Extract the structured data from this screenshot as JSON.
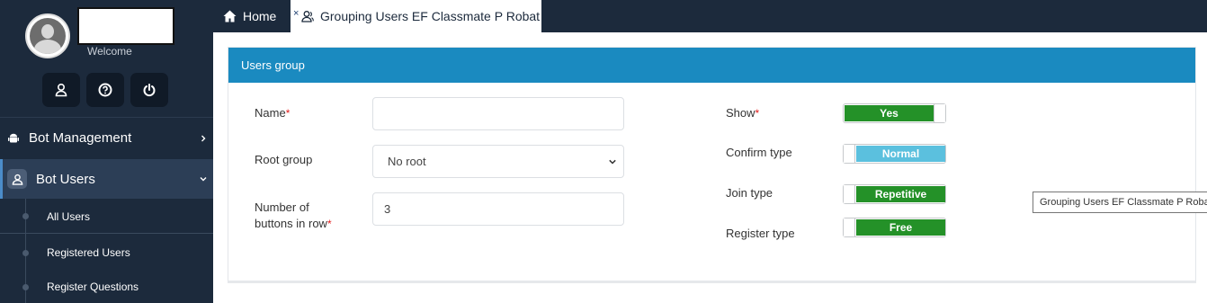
{
  "sidebar": {
    "welcome": "Welcome",
    "icons": [
      "user-profile-icon",
      "help-icon",
      "power-icon"
    ],
    "menu": [
      {
        "label": "Bot Management",
        "icon": "android-icon"
      },
      {
        "label": "Bot Users",
        "icon": "users-icon",
        "expanded": true
      }
    ],
    "submenu": [
      {
        "label": "All Users",
        "active": true
      },
      {
        "label": "Registered Users"
      },
      {
        "label": "Register Questions"
      }
    ]
  },
  "tabs": {
    "home": "Home",
    "active": "Grouping Users EF Classmate P Robat",
    "close": "×"
  },
  "form": {
    "title": "Users group",
    "required_mark": "*",
    "name": {
      "label": "Name",
      "value": ""
    },
    "root_group": {
      "label": "Root group",
      "value": "No root"
    },
    "buttons_in_row": {
      "label_line1": "Number of",
      "label_line2": "buttons in row",
      "value": "3"
    },
    "show": {
      "label": "Show",
      "value": "Yes",
      "color": "#249128"
    },
    "confirm_type": {
      "label": "Confirm type",
      "value": "Normal",
      "color": "#5bc0de"
    },
    "join_type": {
      "label": "Join type",
      "value": "Repetitive",
      "color": "#249128"
    },
    "register_type": {
      "label": "Register type",
      "value": "Free",
      "color": "#249128"
    }
  },
  "tooltip": "Grouping Users EF Classmate P Robat",
  "colors": {
    "sidebar": "#1c2a3c",
    "header": "#1a8ac0",
    "success": "#249128",
    "info": "#5bc0de",
    "required": "#e21b1b"
  }
}
